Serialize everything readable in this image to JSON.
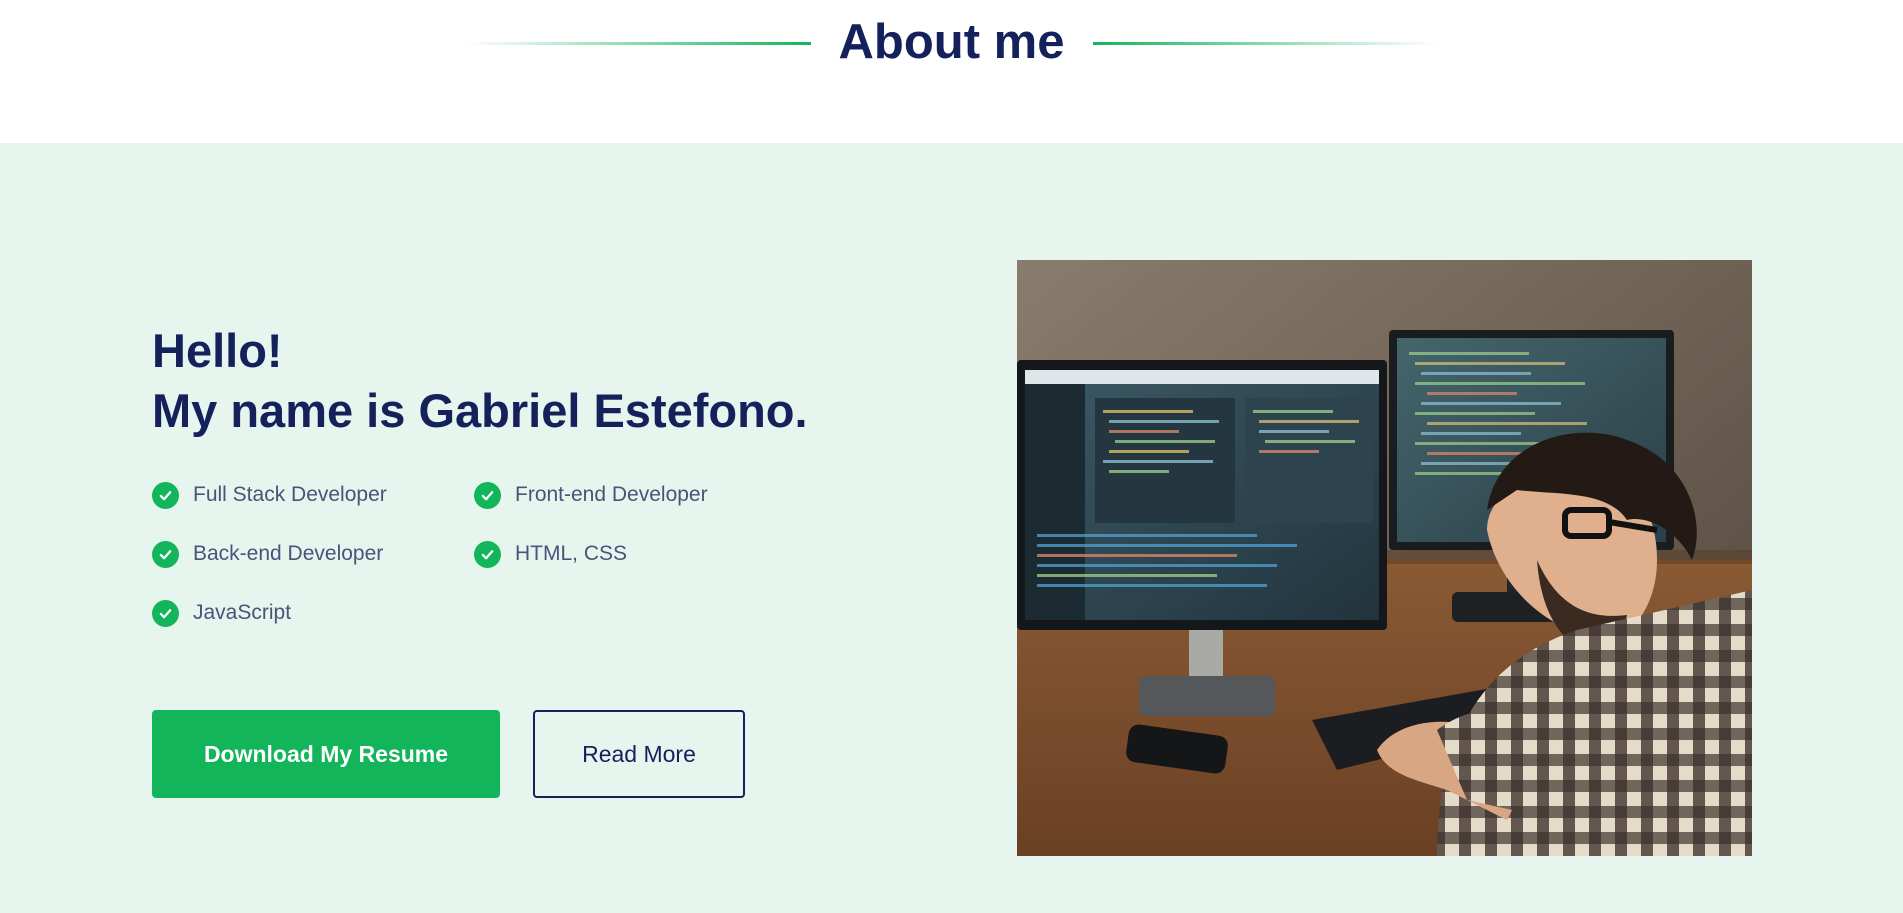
{
  "header": {
    "title": "About me",
    "accent_color": "#12b55a",
    "title_color": "#15215b"
  },
  "about": {
    "background_color": "#e6f6ee",
    "greeting_line1": "Hello!",
    "greeting_line2": "My name is Gabriel Estefono.",
    "skills": [
      {
        "label": "Full Stack Developer",
        "icon": "check-circle-icon"
      },
      {
        "label": "Front-end Developer",
        "icon": "check-circle-icon"
      },
      {
        "label": "Back-end Developer",
        "icon": "check-circle-icon"
      },
      {
        "label": "HTML, CSS",
        "icon": "check-circle-icon"
      },
      {
        "label": "JavaScript",
        "icon": "check-circle-icon"
      }
    ],
    "primary_button_label": "Download My Resume",
    "secondary_button_label": "Read More",
    "photo_alt": "developer-at-dual-monitor-workstation"
  }
}
